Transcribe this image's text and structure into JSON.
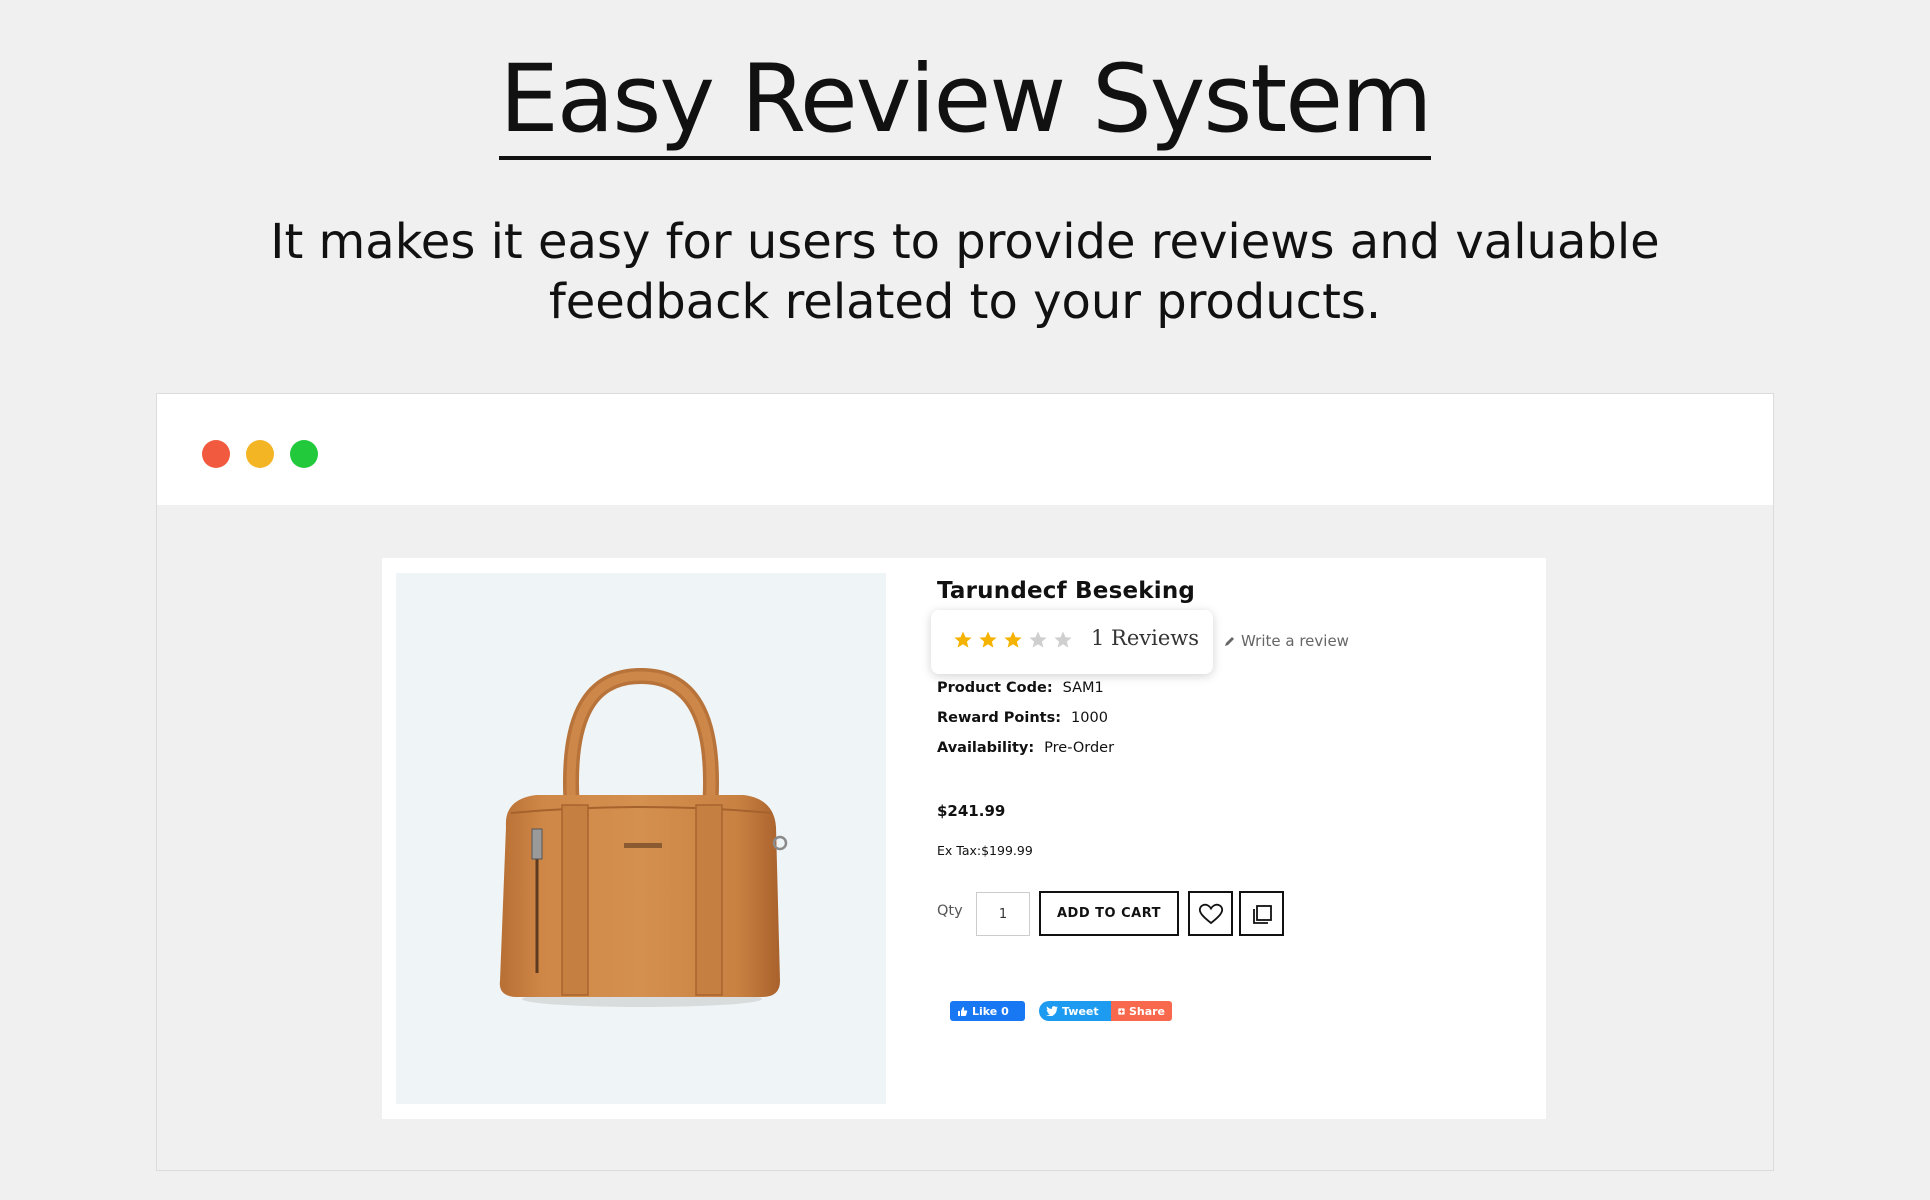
{
  "hero": {
    "title": "Easy Review System",
    "subtitle_line1": "It makes it easy for users to provide reviews and valuable",
    "subtitle_line2": "feedback related to your products."
  },
  "window_controls": {
    "close_color": "#f15a3e",
    "minimize_color": "#f4b525",
    "maximize_color": "#22c93a"
  },
  "product": {
    "title": "Tarundecf Beseking",
    "rating": {
      "value": 3,
      "max": 5,
      "reviews_label": "1 Reviews",
      "star_color": "#f5b301",
      "empty_star_color": "#cfcfcf"
    },
    "write_review_label": "Write a review",
    "specs": [
      {
        "label": "Product Code:",
        "value": "SAM1"
      },
      {
        "label": "Reward Points:",
        "value": "1000"
      },
      {
        "label": "Availability:",
        "value": "Pre-Order"
      }
    ],
    "price": "$241.99",
    "ex_tax": "Ex Tax:$199.99",
    "qty_label": "Qty",
    "qty_value": "1",
    "add_to_cart_label": "ADD TO CART",
    "wishlist_icon": "heart-icon",
    "compare_icon": "compare-icon",
    "social": {
      "like_label": "Like 0",
      "tweet_label": "Tweet",
      "share_label": "Share"
    }
  }
}
